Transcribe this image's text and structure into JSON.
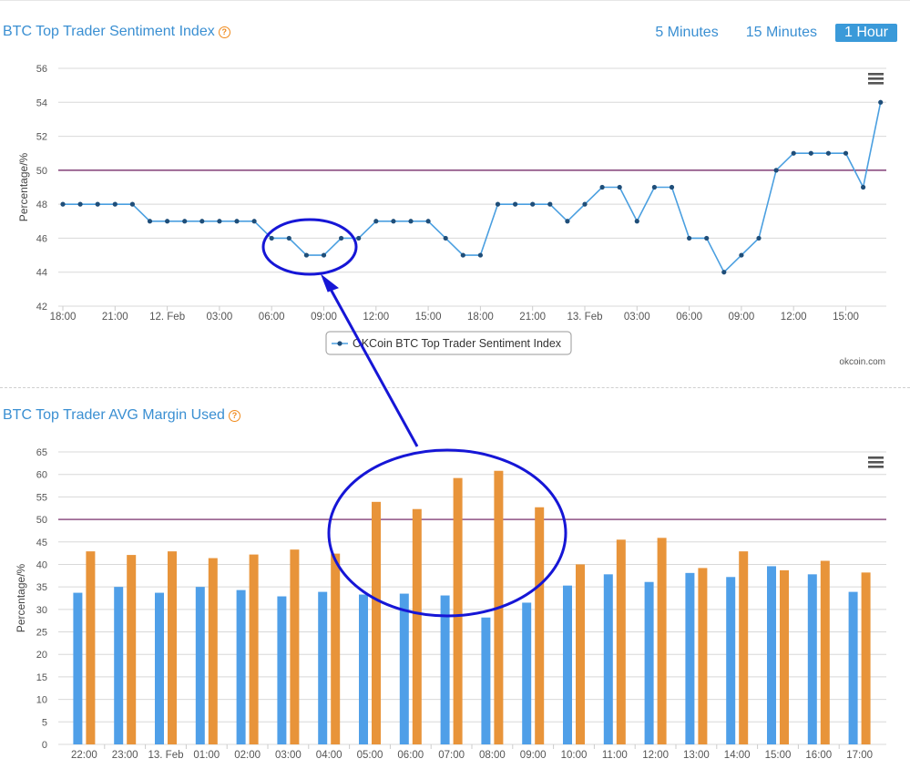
{
  "header": {
    "title": "BTC Top Trader Sentiment Index",
    "help": "?",
    "timeframes": [
      {
        "label": "5 Minutes",
        "active": false
      },
      {
        "label": "15 Minutes",
        "active": false
      },
      {
        "label": "1 Hour",
        "active": true
      }
    ]
  },
  "section2": {
    "title": "BTC Top Trader AVG Margin Used",
    "help": "?"
  },
  "colors": {
    "line": "#4a9fe0",
    "marker": "#1f4e79",
    "ref_line": "#6b1a5e",
    "bar_blue": "#4f9fe8",
    "bar_orange": "#e8943a",
    "annotation": "#1616d6"
  },
  "chart_data": [
    {
      "type": "line",
      "title": "BTC Top Trader Sentiment Index",
      "ylabel": "Percentage/%",
      "ylim": [
        42,
        56
      ],
      "yticks": [
        42,
        44,
        46,
        48,
        50,
        52,
        54,
        56
      ],
      "xticks": [
        "18:00",
        "21:00",
        "12. Feb",
        "03:00",
        "06:00",
        "09:00",
        "12:00",
        "15:00",
        "18:00",
        "21:00",
        "13. Feb",
        "03:00",
        "06:00",
        "09:00",
        "12:00",
        "15:00"
      ],
      "reference_line": 50,
      "series": [
        {
          "name": "OKCoin BTC Top Trader Sentiment Index",
          "values": [
            48,
            48,
            48,
            48,
            48,
            47,
            47,
            47,
            47,
            47,
            47,
            47,
            46,
            46,
            45,
            45,
            46,
            46,
            47,
            47,
            47,
            47,
            46,
            45,
            45,
            48,
            48,
            48,
            48,
            47,
            48,
            49,
            49,
            47,
            49,
            49,
            46,
            46,
            44,
            45,
            46,
            50,
            51,
            51,
            51,
            51,
            49,
            54
          ]
        }
      ],
      "legend": "bottom-center",
      "credit": "okcoin.com",
      "menu_icon": "hamburger-menu-icon",
      "annotation": {
        "shape": "ellipse",
        "around_values": [
          45,
          45
        ],
        "arrow_to": "bar chart ellipse"
      }
    },
    {
      "type": "bar",
      "title": "BTC Top Trader AVG Margin Used",
      "ylabel": "Percentage/%",
      "ylim": [
        0,
        65
      ],
      "yticks": [
        0,
        5,
        10,
        15,
        20,
        25,
        30,
        35,
        40,
        45,
        50,
        55,
        60,
        65
      ],
      "categories": [
        "22:00",
        "23:00",
        "13. Feb",
        "01:00",
        "02:00",
        "03:00",
        "04:00",
        "05:00",
        "06:00",
        "07:00",
        "08:00",
        "09:00",
        "10:00",
        "11:00",
        "12:00",
        "13:00",
        "14:00",
        "15:00",
        "16:00",
        "17:00"
      ],
      "reference_line": 50,
      "series": [
        {
          "values": [
            33.7,
            35,
            33.7,
            35,
            34.3,
            32.9,
            33.9,
            33.3,
            33.5,
            33.1,
            28.2,
            31.5,
            35.3,
            37.8,
            36.1,
            38.1,
            37.2,
            39.6,
            37.8,
            33.9
          ]
        },
        {
          "values": [
            42.9,
            42.1,
            42.9,
            41.4,
            42.2,
            43.3,
            42.4,
            53.9,
            52.3,
            59.2,
            60.8,
            52.7,
            40,
            45.5,
            45.9,
            39.2,
            42.9,
            38.7,
            40.8,
            38.2
          ]
        }
      ],
      "menu_icon": "hamburger-menu-icon",
      "annotation": {
        "shape": "ellipse",
        "around_categories": [
          "05:00",
          "09:00"
        ]
      }
    }
  ]
}
